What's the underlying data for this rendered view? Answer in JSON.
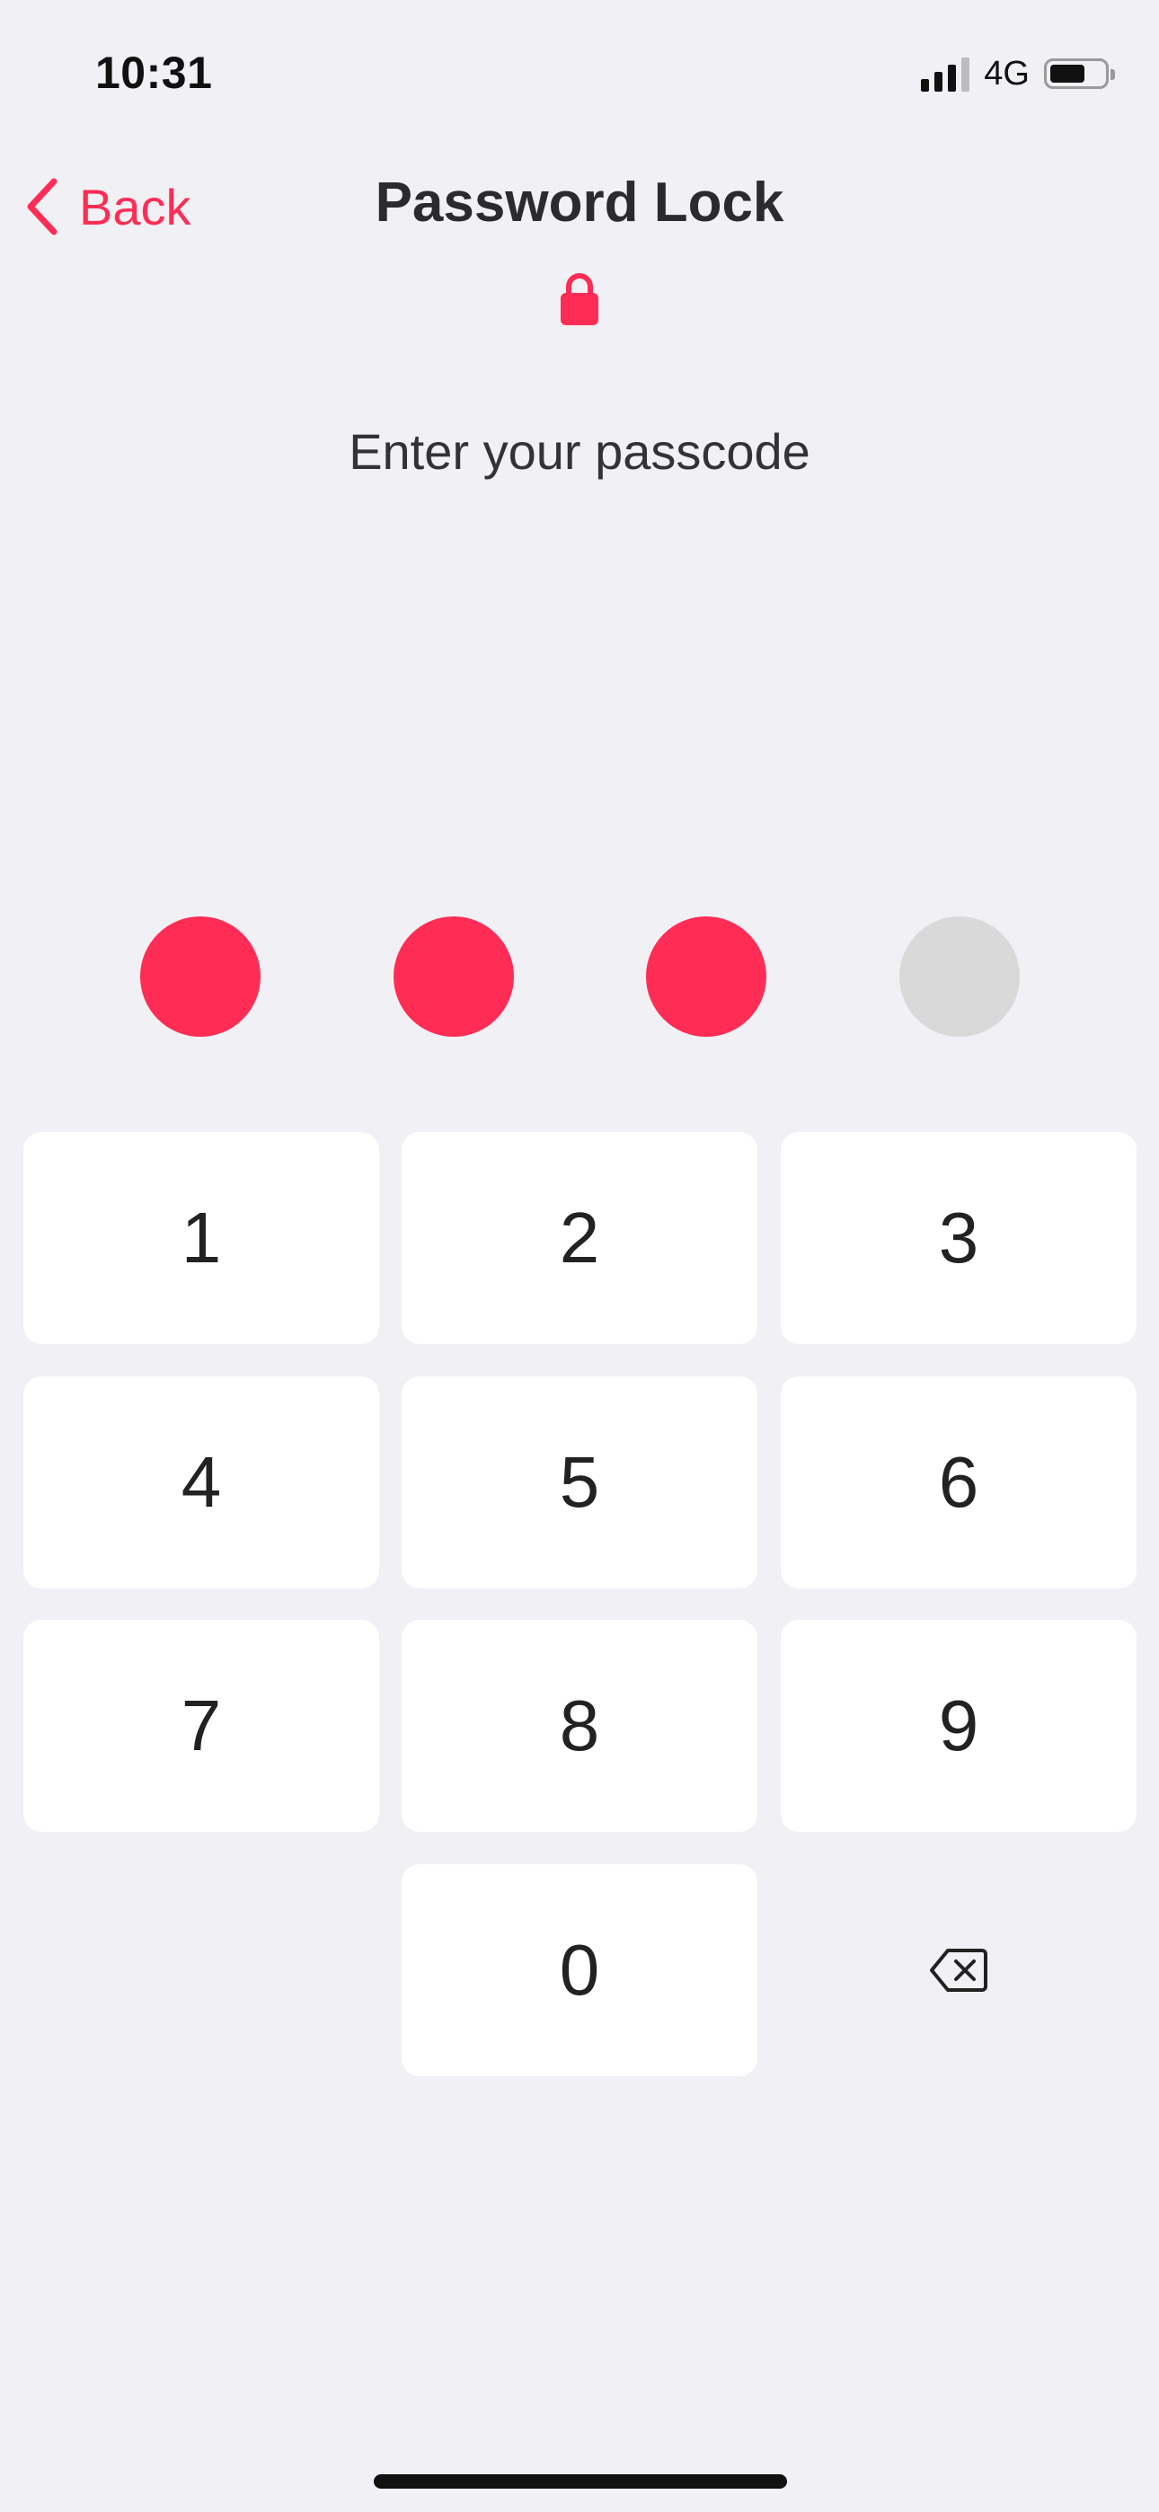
{
  "status_bar": {
    "time": "10:31",
    "network": "4G",
    "signal_bars_active": 3,
    "signal_bars_total": 4,
    "battery_level": 0.65
  },
  "nav": {
    "back_label": "Back",
    "title": "Password Lock",
    "back_icon": "chevron-left-icon",
    "lock_icon": "lock-icon"
  },
  "prompt": "Enter your passcode",
  "passcode": {
    "length": 4,
    "entered": 3
  },
  "keypad": {
    "keys": [
      "1",
      "2",
      "3",
      "4",
      "5",
      "6",
      "7",
      "8",
      "9",
      "",
      "0",
      "delete"
    ],
    "delete_icon": "backspace-icon"
  },
  "colors": {
    "accent": "#ff2d55",
    "background": "#f0f0f5",
    "key_background": "#ffffff",
    "dot_empty": "#d9d9d9",
    "text": "#2b2b2e"
  }
}
